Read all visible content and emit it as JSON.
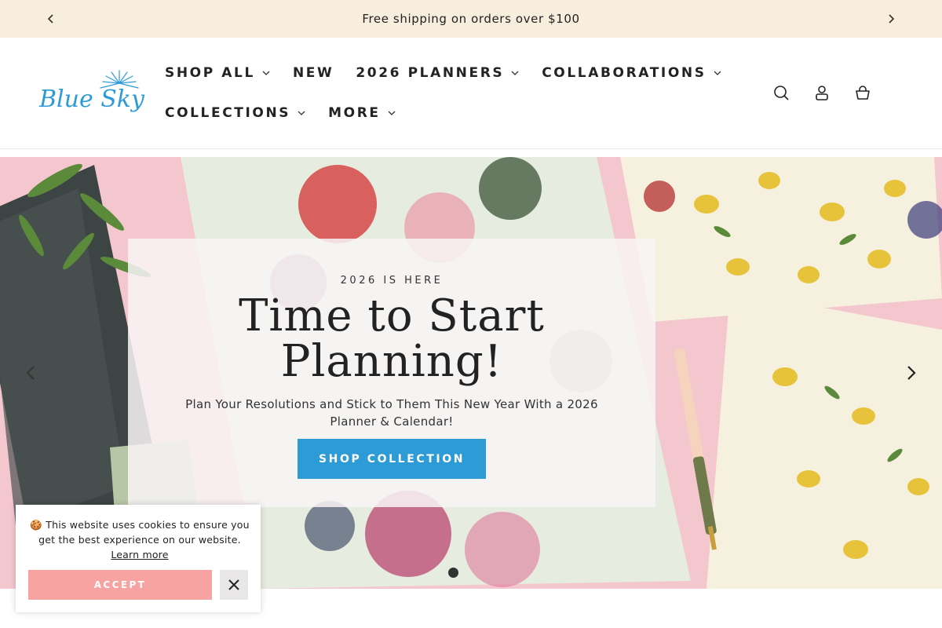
{
  "announcement": {
    "text": "Free shipping on orders over $100",
    "prev_icon": "chevron-left-icon",
    "next_icon": "chevron-right-icon"
  },
  "header": {
    "logo_text": "Blue Sky",
    "nav": [
      {
        "label": "SHOP ALL",
        "has_dropdown": true
      },
      {
        "label": "NEW",
        "has_dropdown": false
      },
      {
        "label": "2026 PLANNERS",
        "has_dropdown": true
      },
      {
        "label": "COLLABORATIONS",
        "has_dropdown": true
      },
      {
        "label": "COLLECTIONS",
        "has_dropdown": true
      },
      {
        "label": "MORE",
        "has_dropdown": true
      }
    ],
    "icons": [
      "search-icon",
      "account-icon",
      "cart-icon"
    ]
  },
  "hero": {
    "eyebrow": "2026 IS HERE",
    "title": "Time to Start Planning!",
    "subtitle": "Plan Your Resolutions and Stick to Them This New Year With a 2026 Planner & Calendar!",
    "button_label": "SHOP COLLECTION",
    "active_slide": 1,
    "slide_count": 1
  },
  "cookie_banner": {
    "icon": "cookie-icon",
    "text": "This website uses cookies to ensure you get the best experience on our website.",
    "link_text": "Learn more",
    "accept_label": "ACCEPT",
    "close_icon": "close-icon"
  },
  "colors": {
    "announcement_bg": "#f7eedd",
    "accent_blue": "#2d9bd6",
    "hero_pink": "#f4c7cf",
    "accept_pink": "#f7a3a1"
  }
}
